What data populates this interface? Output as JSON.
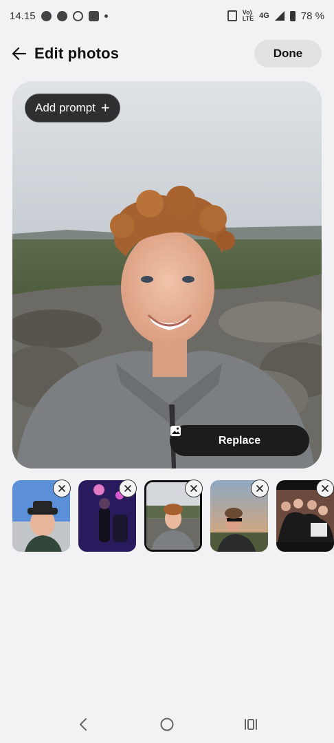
{
  "status_bar": {
    "time": "14.15",
    "network_small_top": "Vo)",
    "network_small_bottom": "LTE",
    "network_type": "4G",
    "battery": "78 %"
  },
  "header": {
    "title": "Edit photos",
    "done_label": "Done",
    "back_icon": "arrow-left-icon"
  },
  "main_photo": {
    "add_prompt_label": "Add prompt",
    "replace_label": "Replace"
  },
  "thumbnails": [
    {
      "subject": "boy-in-black-hat",
      "selected": false
    },
    {
      "subject": "band-on-stage",
      "selected": false
    },
    {
      "subject": "boy-smiling-selfie",
      "selected": true
    },
    {
      "subject": "boy-sunglasses-sunset",
      "selected": false
    },
    {
      "subject": "group-of-friends",
      "selected": false
    }
  ],
  "colors": {
    "background": "#f2f2f4",
    "dark_button": "#1c1c1c",
    "done_button": "#e2e2e4"
  }
}
